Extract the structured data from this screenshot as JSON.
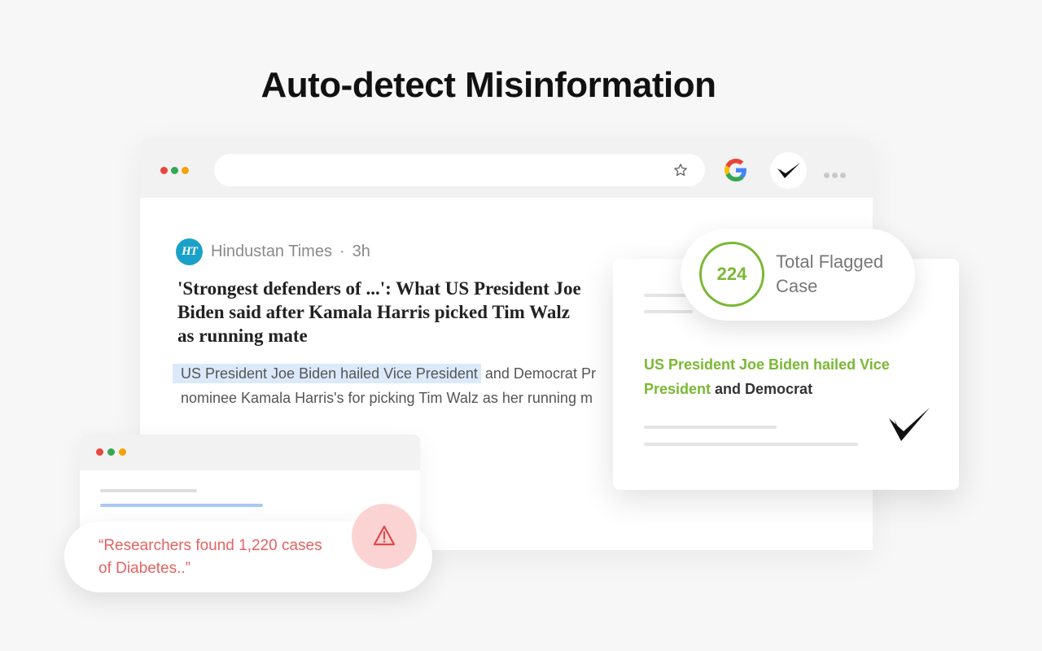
{
  "headline": "Auto-detect Misinformation",
  "colors": {
    "background": "#f7f7f7",
    "accent_green": "#7ab833",
    "warning_red": "#e66262",
    "highlight_blue": "#dbe9fb",
    "dot_red": "#e8453c",
    "dot_green": "#34a853",
    "dot_yellow": "#f4a300"
  },
  "browser": {
    "window_dots": [
      "red",
      "green",
      "yellow"
    ],
    "icons": [
      "star-icon",
      "google-icon",
      "checkmark-extension-icon",
      "more-icon"
    ]
  },
  "article": {
    "source_logo": "HT",
    "source_name": "Hindustan Times",
    "separator": "·",
    "time": "3h",
    "title": "'Strongest defenders of ...': What US President Joe Biden said after Kamala Harris picked Tim Walz as running mate",
    "body_highlighted": "US President Joe Biden hailed Vice President",
    "body_rest_line1": " and Democrat Pr",
    "body_line2": "nominee Kamala Harris's for picking Tim Walz as her running m"
  },
  "quote_card": {
    "text": "“Researchers found 1,220 cases of Diabetes..”",
    "icon": "warning-icon"
  },
  "flagged": {
    "count": "224",
    "label": "Total Flagged Case"
  },
  "result_card": {
    "green_text": "US President Joe Biden hailed Vice President",
    "dark_text": " and Democrat",
    "icon": "checkmark-icon"
  }
}
